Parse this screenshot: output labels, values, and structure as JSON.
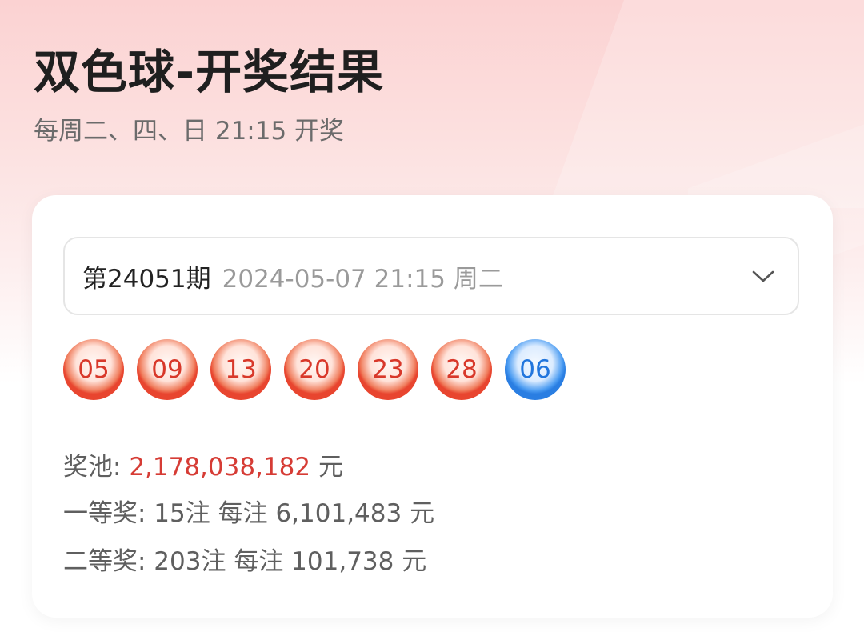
{
  "header": {
    "title": "双色球-开奖结果",
    "subtitle": "每周二、四、日 21:15 开奖"
  },
  "draw": {
    "issue": "第24051期",
    "datetime": "2024-05-07 21:15 周二",
    "selector_icon": "chevron-down-icon",
    "red_balls": [
      "05",
      "09",
      "13",
      "20",
      "23",
      "28"
    ],
    "blue_ball": "06"
  },
  "prize": {
    "pool_label": "奖池: ",
    "pool_value": "2,178,038,182",
    "pool_unit": " 元",
    "first": "一等奖: 15注 每注 6,101,483 元",
    "second": "二等奖: 203注 每注 101,738 元"
  },
  "colors": {
    "red_ball": "#e8452f",
    "blue_ball": "#2a7ee2",
    "pool_highlight": "#d63c35"
  }
}
